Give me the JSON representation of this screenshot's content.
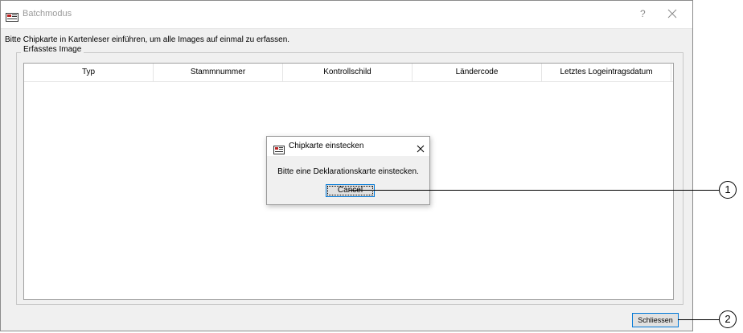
{
  "window": {
    "title": "Batchmodus",
    "help_label": "?"
  },
  "main": {
    "instruction": "Bitte Chipkarte in Kartenleser einführen, um alle Images auf einmal zu erfassen.",
    "group_label": "Erfasstes Image",
    "table": {
      "columns": [
        "Typ",
        "Stammnummer",
        "Kontrollschild",
        "Ländercode",
        "Letztes Logeintragsdatum"
      ],
      "rows": []
    },
    "close_button_label": "Schliessen"
  },
  "dialog": {
    "title": "Chipkarte einstecken",
    "message": "Bitte eine Deklarationskarte einstecken.",
    "cancel_label": "Cancel"
  },
  "callouts": {
    "items": [
      {
        "number": "1"
      },
      {
        "number": "2"
      }
    ]
  },
  "colors": {
    "accent": "#0078d7",
    "window_background": "#f0f0f0"
  }
}
